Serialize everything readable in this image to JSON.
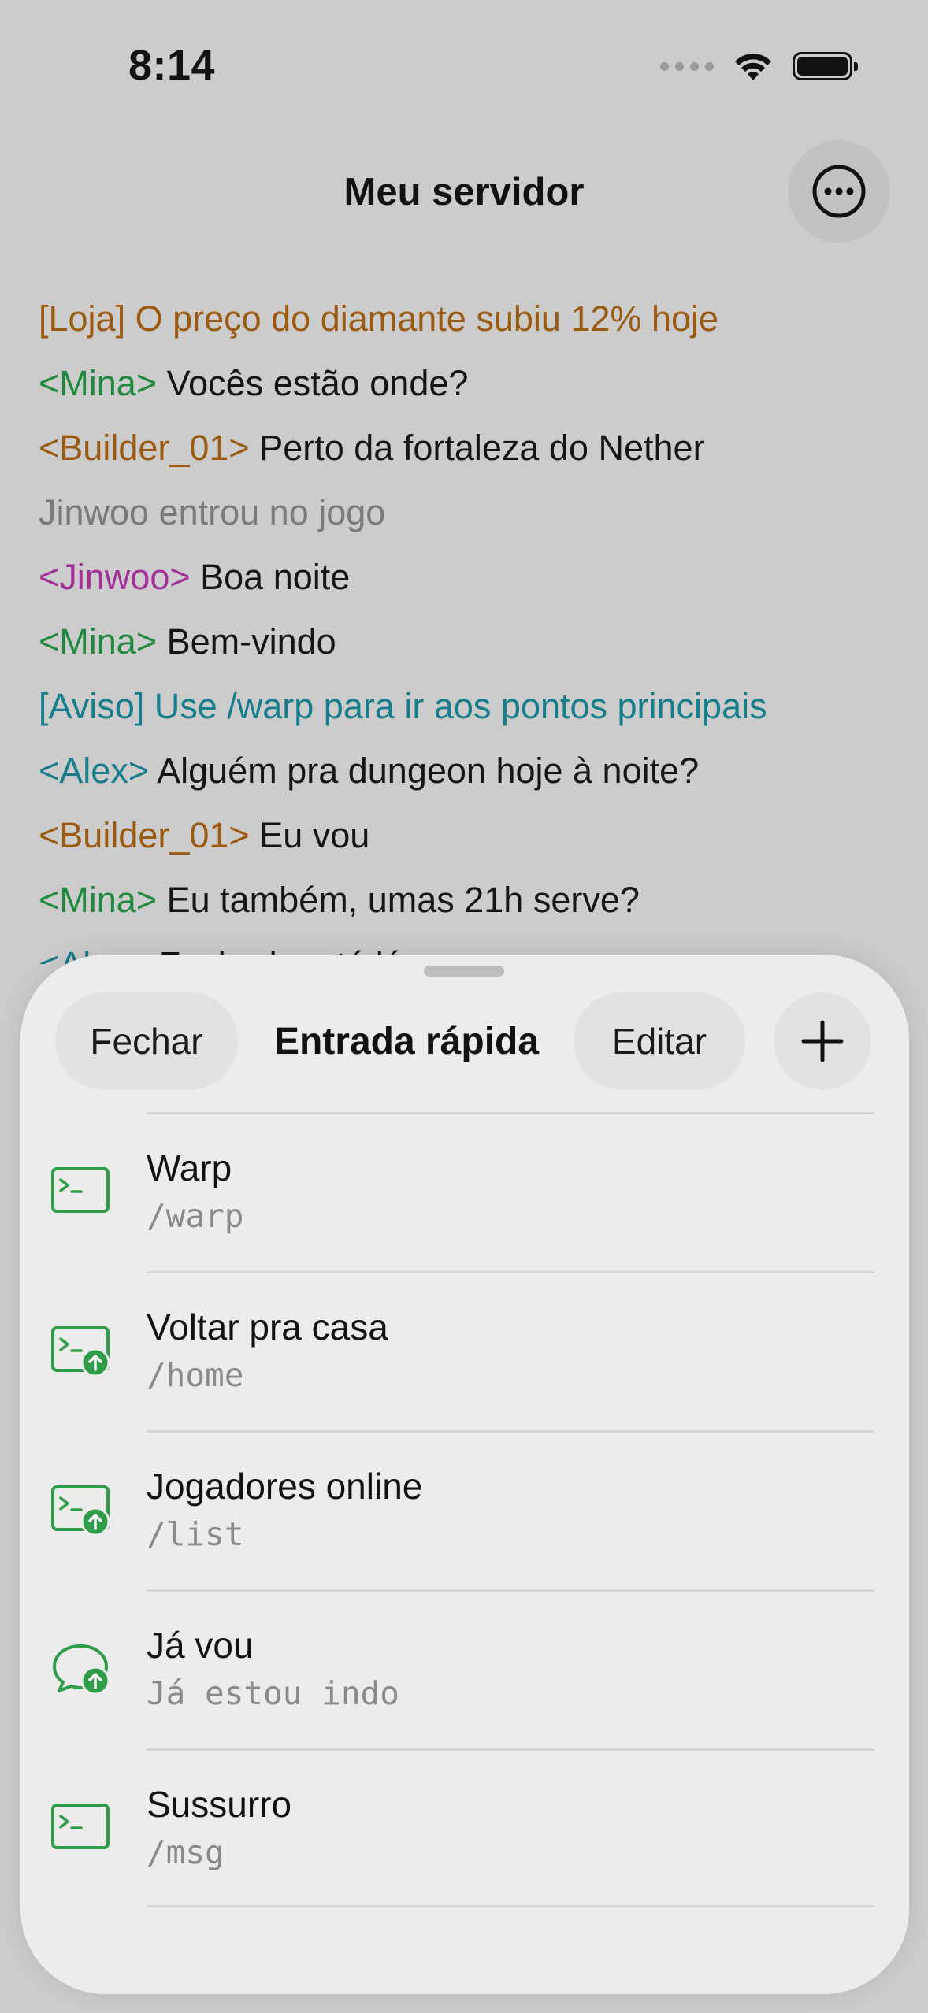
{
  "status_bar": {
    "time": "8:14"
  },
  "header": {
    "title": "Meu servidor"
  },
  "chat": [
    {
      "name": "[Loja] O preço do diamante subiu 12% hoje",
      "msg": "",
      "color": "#9b5a12"
    },
    {
      "name": "<Mina>",
      "msg": " Vocês estão onde?",
      "color": "#1f8a3e"
    },
    {
      "name": "<Builder_01>",
      "msg": " Perto da fortaleza do Nether",
      "color": "#9b5a12"
    },
    {
      "name": "Jinwoo entrou no jogo",
      "msg": "",
      "color": "#7a7a7a"
    },
    {
      "name": "<Jinwoo>",
      "msg": " Boa noite",
      "color": "#a3309a"
    },
    {
      "name": "<Mina>",
      "msg": " Bem-vindo",
      "color": "#1f8a3e"
    },
    {
      "name": "[Aviso] Use /warp para ir aos pontos principais",
      "msg": "",
      "color": "#167d8c"
    },
    {
      "name": "<Alex>",
      "msg": " Alguém pra dungeon hoje à noite?",
      "color": "#167d8c"
    },
    {
      "name": "<Builder_01>",
      "msg": " Eu vou",
      "color": "#9b5a12"
    },
    {
      "name": "<Mina>",
      "msg": " Eu também, umas 21h serve?",
      "color": "#1f8a3e"
    },
    {
      "name": "<Alex>",
      "msg": " Fechado, até lá",
      "color": "#167d8c"
    }
  ],
  "sheet": {
    "close_label": "Fechar",
    "title": "Entrada rápida",
    "edit_label": "Editar",
    "items": [
      {
        "title": "Warp",
        "subtitle": "/warp",
        "icon": "terminal-icon"
      },
      {
        "title": "Voltar pra casa",
        "subtitle": "/home",
        "icon": "terminal-send-icon"
      },
      {
        "title": "Jogadores online",
        "subtitle": "/list",
        "icon": "terminal-send-icon"
      },
      {
        "title": "Já vou",
        "subtitle": "Já estou indo",
        "icon": "chat-send-icon"
      },
      {
        "title": "Sussurro",
        "subtitle": "/msg",
        "icon": "terminal-icon"
      }
    ]
  },
  "colors": {
    "accent": "#2e9c48",
    "sheet_bg": "#ececec",
    "page_bg": "#cccccc"
  }
}
